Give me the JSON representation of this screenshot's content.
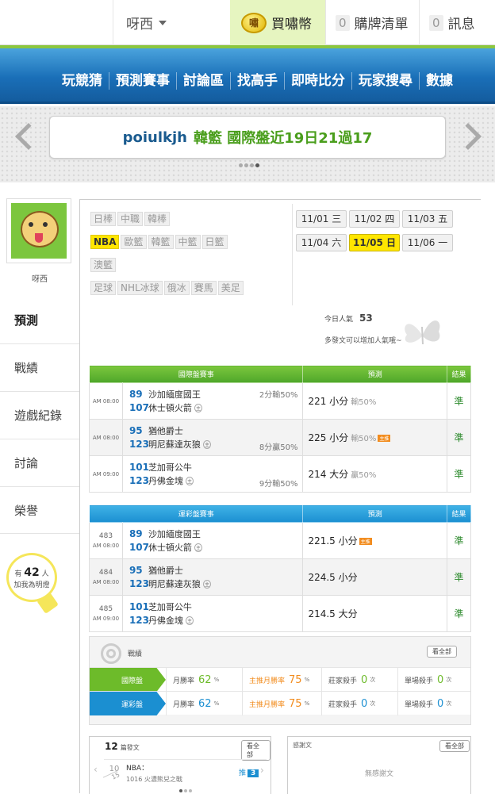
{
  "topbar": {
    "username": "呀西",
    "buy_label": "買嘯幣",
    "coin_text": "嘯",
    "cart_label": "購牌清單",
    "cart_count": "0",
    "msg_label": "訊息",
    "msg_count": "0"
  },
  "nav": [
    "玩競猜",
    "預測賽事",
    "討論區",
    "找高手",
    "即時比分",
    "玩家搜尋",
    "數據"
  ],
  "banner": {
    "user": "poiulkjh",
    "message": "韓籃 國際盤近19日21過17"
  },
  "sidebar": {
    "name": "呀西",
    "tabs": [
      "預測",
      "戰績",
      "遊戲紀錄",
      "討論",
      "榮譽"
    ],
    "fans_prefix": "有",
    "fans_count": "42",
    "fans_unit": "人",
    "fans_suffix": "加我為明燈"
  },
  "leagues": [
    [
      "日棒",
      "中職",
      "韓棒"
    ],
    [
      "NBA",
      "歐籃",
      "韓籃",
      "中籃",
      "日籃"
    ],
    [
      "澳籃"
    ],
    [
      "足球",
      "NHL冰球",
      "俄冰",
      "賽馬",
      "美足"
    ]
  ],
  "selected_league": "NBA",
  "dates": [
    [
      "11/01 三",
      "11/02 四",
      "11/03 五"
    ],
    [
      "11/04 六",
      "11/05 日",
      "11/06 一"
    ]
  ],
  "selected_date": "11/05 日",
  "popularity": {
    "label": "今日人氣",
    "value": "53",
    "tip": "多發文可以增加人氣哦~"
  },
  "intl_table": {
    "headers": [
      "國際盤賽事",
      "預測",
      "結果"
    ],
    "rows": [
      {
        "time": "AM 08:00",
        "away_no": "89",
        "away": "沙加緬度國王",
        "home_no": "107",
        "home": "休士頓火箭",
        "spread": "2分輸50%",
        "spread_row": "away",
        "pick": "221 小分",
        "pick_sub": "輸50%",
        "hot": "",
        "result": "準"
      },
      {
        "time": "AM 08:00",
        "away_no": "95",
        "away": "猶他爵士",
        "home_no": "123",
        "home": "明尼蘇達灰狼",
        "spread": "8分贏50%",
        "spread_row": "home",
        "pick": "225 小分",
        "pick_sub": "輸50%",
        "hot": "主推",
        "result": "準"
      },
      {
        "time": "AM 09:00",
        "away_no": "101",
        "away": "芝加哥公牛",
        "home_no": "123",
        "home": "丹佛金塊",
        "spread": "9分輸50%",
        "spread_row": "home",
        "pick": "214 大分",
        "pick_sub": "贏50%",
        "hot": "",
        "result": "準"
      }
    ]
  },
  "lottery_table": {
    "headers": [
      "運彩盤賽事",
      "預測",
      "結果"
    ],
    "rows": [
      {
        "no": "483",
        "time": "AM 08:00",
        "away_no": "89",
        "away": "沙加緬度國王",
        "home_no": "107",
        "home": "休士頓火箭",
        "pick": "221.5 小分",
        "hot": "主推",
        "result": "準"
      },
      {
        "no": "484",
        "time": "AM 08:00",
        "away_no": "95",
        "away": "猶他爵士",
        "home_no": "123",
        "home": "明尼蘇達灰狼",
        "pick": "224.5 小分",
        "hot": "",
        "result": "準"
      },
      {
        "no": "485",
        "time": "AM 09:00",
        "away_no": "101",
        "away": "芝加哥公牛",
        "home_no": "123",
        "home": "丹佛金塊",
        "pick": "214.5 大分",
        "hot": "",
        "result": "準"
      }
    ]
  },
  "home_mark": "主",
  "record": {
    "title": "戰績",
    "view_all": "看全部",
    "rows": [
      {
        "tag": "國際盤",
        "color": "#6dbb2a",
        "month_label": "月勝率",
        "month_val": "62",
        "main_label": "主推月勝率",
        "main_val": "75",
        "banker_label": "莊家殺手",
        "banker_val": "0",
        "single_label": "單場殺手",
        "single_val": "0"
      },
      {
        "tag": "運彩盤",
        "color": "#1b8fd1",
        "month_label": "月勝率",
        "month_val": "62",
        "main_label": "主推月勝率",
        "main_val": "75",
        "banker_label": "莊家殺手",
        "banker_val": "0",
        "single_label": "單場殺手",
        "single_val": "0"
      }
    ],
    "pct_unit": "%",
    "times_unit": "次"
  },
  "posts": {
    "count": "12",
    "label": "篇發文",
    "view_all": "看全部",
    "item": {
      "day": "10",
      "month": "15",
      "title": "NBA：",
      "sub": "1016 火濃熊兒之戰",
      "push_label": "推",
      "push_count": "3"
    }
  },
  "thanks": {
    "title": "感謝文",
    "view_all": "看全部",
    "empty": "無感謝文"
  },
  "colors": {
    "green": "#6dbb2a",
    "blue": "#1b8fd1",
    "yellow": "#ffe600",
    "orange": "#f28c1e"
  }
}
